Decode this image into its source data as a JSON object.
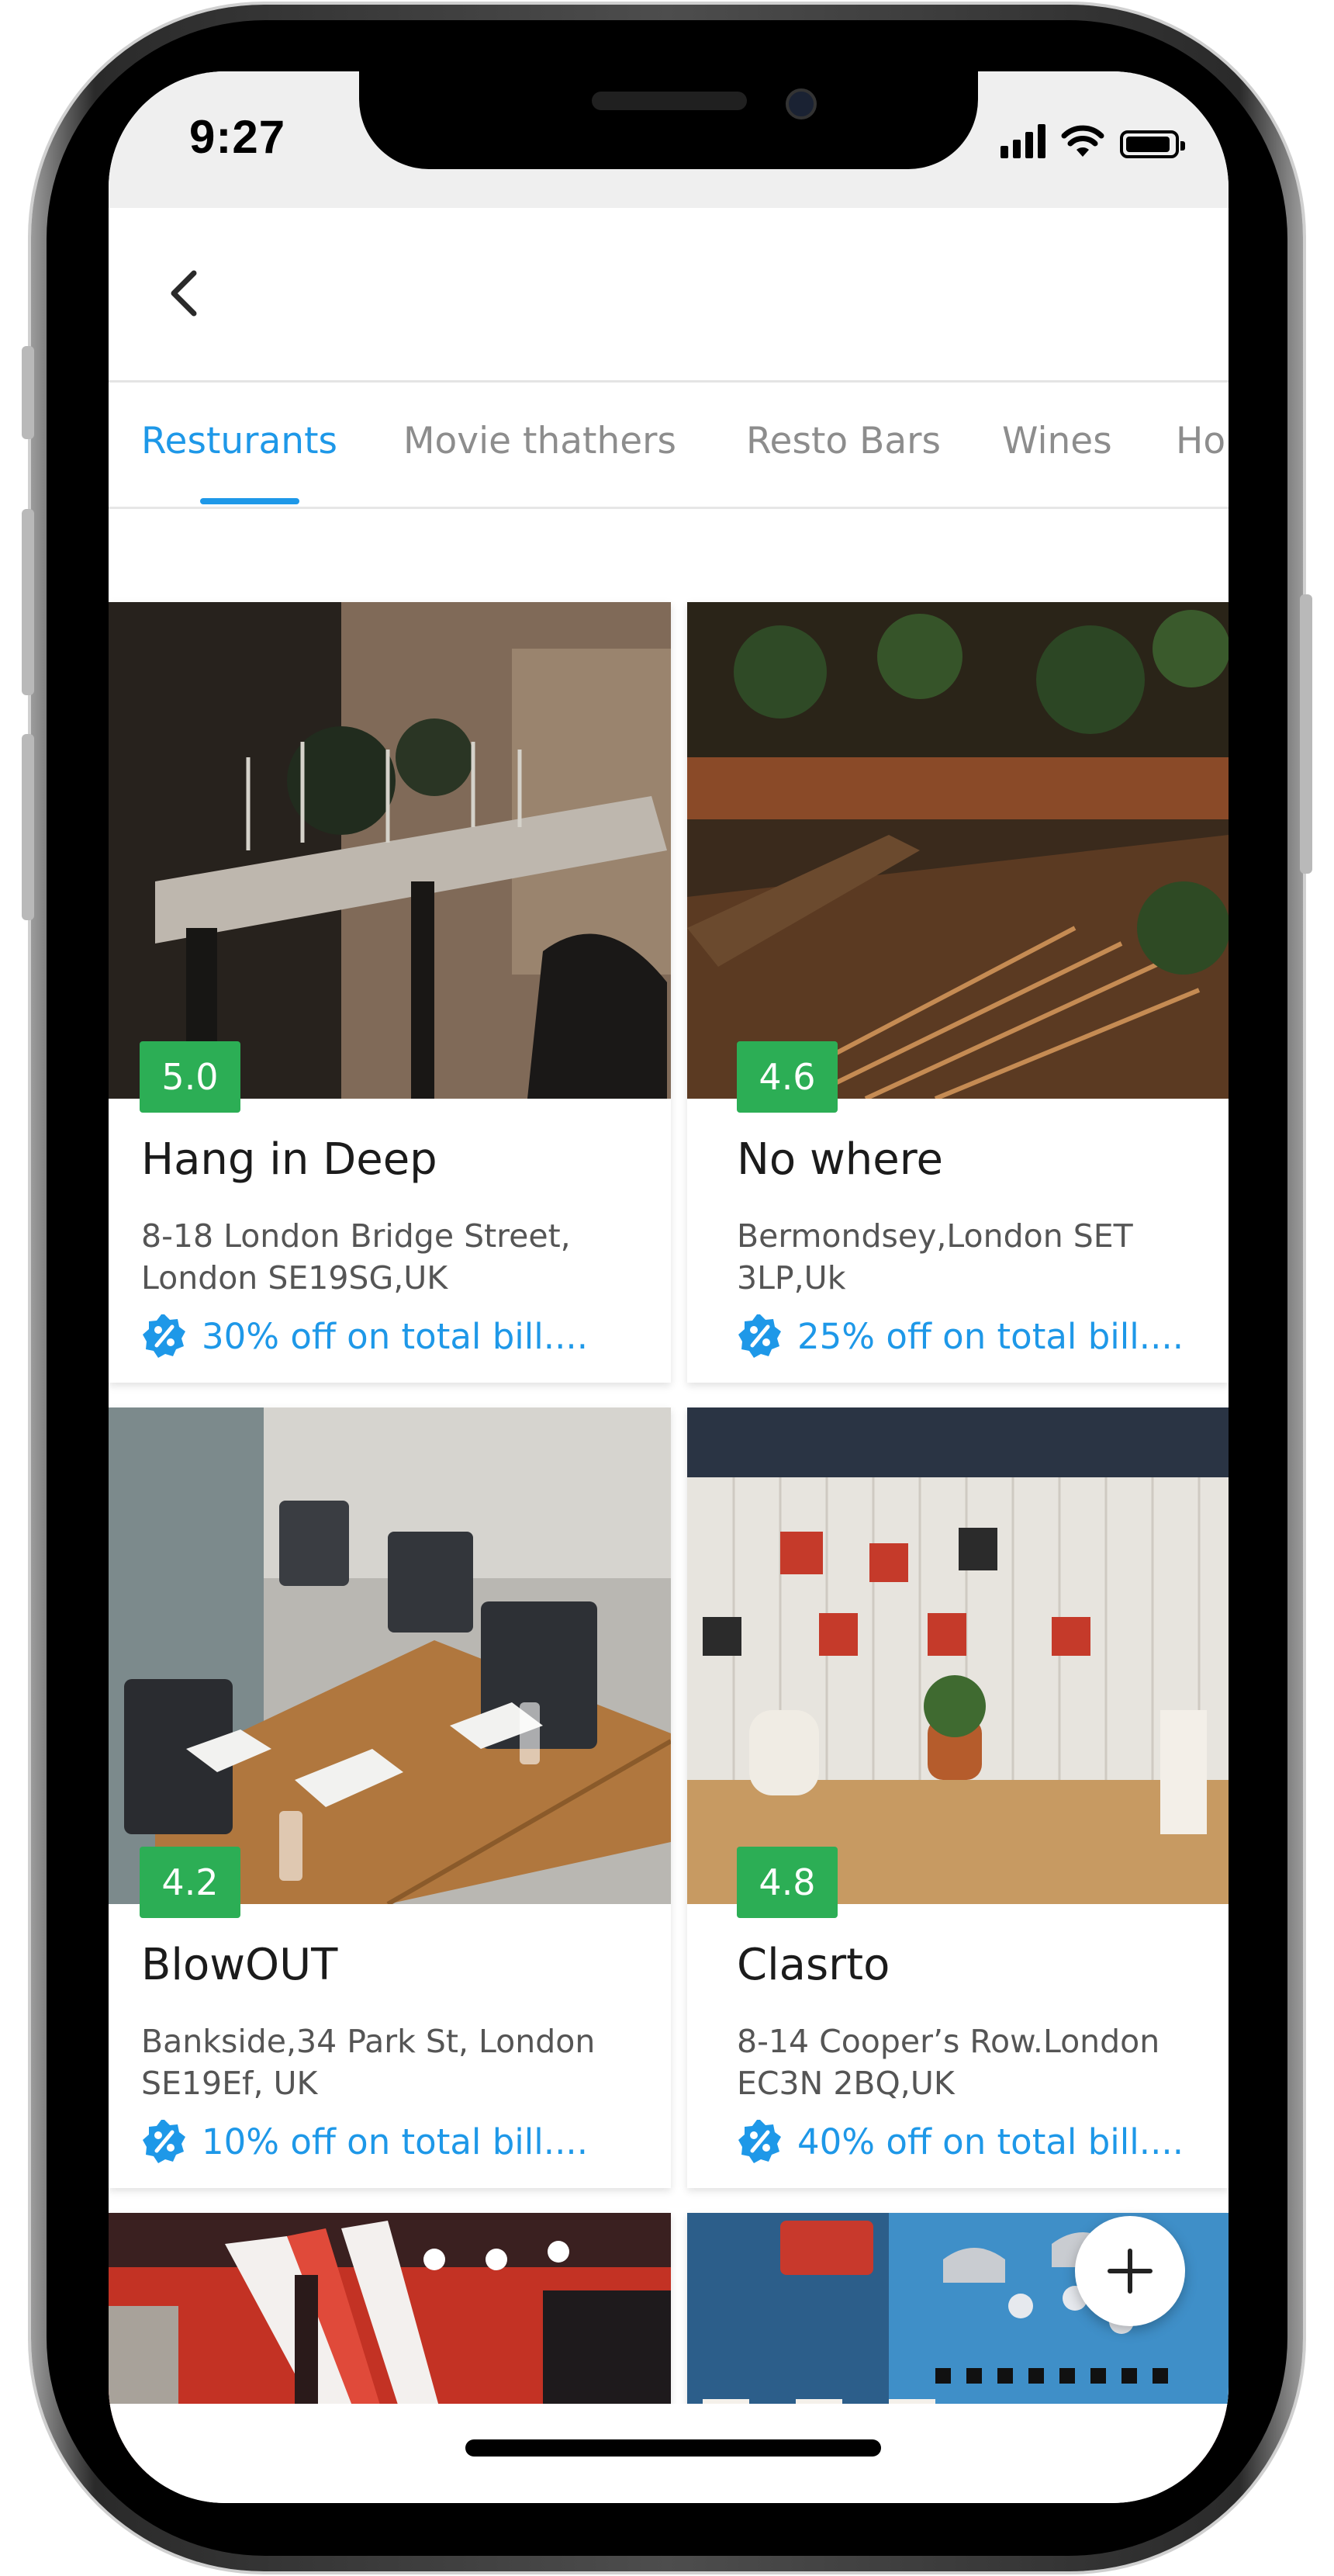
{
  "status_bar": {
    "time": "9:27"
  },
  "header": {
    "back_icon": "chevron-left-icon"
  },
  "tabs": [
    {
      "label": "Resturants",
      "active": true
    },
    {
      "label": "Movie thathers",
      "active": false
    },
    {
      "label": "Resto Bars",
      "active": false
    },
    {
      "label": "Wines",
      "active": false
    },
    {
      "label": "Ho",
      "active": false
    }
  ],
  "colors": {
    "accent": "#1e98e8",
    "rating_badge": "#2cae55",
    "text_primary": "#1b1b1b",
    "text_secondary": "#555555"
  },
  "restaurants": [
    {
      "rating": "5.0",
      "name": "Hang in Deep",
      "address": "8-18 London Bridge Street, London SE19SG,UK",
      "offer": "30% off on total bill...."
    },
    {
      "rating": "4.6",
      "name": "No where",
      "address": "Bermondsey,London SET 3LP,Uk",
      "offer": "25% off on total bill...."
    },
    {
      "rating": "4.2",
      "name": "BlowOUT",
      "address": "Bankside,34 Park St, London SE19Ef, UK",
      "offer": "10% off on total bill...."
    },
    {
      "rating": "4.8",
      "name": "Clasrto",
      "address": "8-14 Cooper’s Row.London EC3N 2BQ,UK",
      "offer": "40% off on total bill...."
    }
  ],
  "fab": {
    "icon": "plus-icon"
  }
}
